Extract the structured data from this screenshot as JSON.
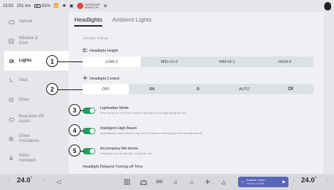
{
  "status_bar": {
    "time": "15:53",
    "range": "251 km",
    "battery": "52%",
    "airbag_line1": "PASSENGER",
    "airbag_line2": "AIRBAG ON"
  },
  "sidebar": {
    "items": [
      {
        "label": "Vehicle",
        "icon": "car-icon"
      },
      {
        "label": "Window &\nDoor",
        "icon": "door-icon"
      },
      {
        "label": "Lights",
        "icon": "headlight-icon"
      },
      {
        "label": "Seat",
        "icon": "seat-icon"
      },
      {
        "label": "Drive",
        "icon": "steering-icon"
      },
      {
        "label": "Real-time VR\nAssist",
        "icon": "vr-icon"
      },
      {
        "label": "Driver\nAssistance",
        "icon": "assist-icon"
      },
      {
        "label": "Voice\nAssistant",
        "icon": "voice-icon"
      }
    ]
  },
  "tabs": [
    "Headlights",
    "Ambient Lights"
  ],
  "subheading": "Headlight Settings",
  "headlight_height": {
    "title": "Headlight Height",
    "options": [
      "LOW-3",
      "MID-LO-2",
      "MID-HI-1",
      "HIGH-0"
    ],
    "selected": "LOW-3"
  },
  "headlight_control": {
    "title": "Headlight Control",
    "options": [
      "OFF",
      "D0",
      "D",
      "AUTO",
      "OI"
    ],
    "selected": "OFF"
  },
  "toggles": [
    {
      "title": "Lightsaber Mode",
      "desc": "When turned on, the Front Position Light will be lit on high during the day.",
      "on": true
    },
    {
      "title": "Intelligent High Beam",
      "desc": "Automatically switch between high and low beams, reducing night-time driving hazards.",
      "on": true
    },
    {
      "title": "Accompany Me Home",
      "desc": "Headlights turn off later after locking the car.",
      "on": true
    }
  ],
  "bottom_title": "Headlight Delayed Turning off Time",
  "callouts": [
    "1",
    "2",
    "3",
    "4",
    "5"
  ],
  "dock": {
    "left_temp": "24.0",
    "right_temp": "24.0",
    "deg": "°",
    "media_line1": "Anytime, Anyw...",
    "media_line2": "Various Artists",
    "colors": {
      "accent_green": "#1f9d5d",
      "media_bg": "#5865b8"
    }
  }
}
